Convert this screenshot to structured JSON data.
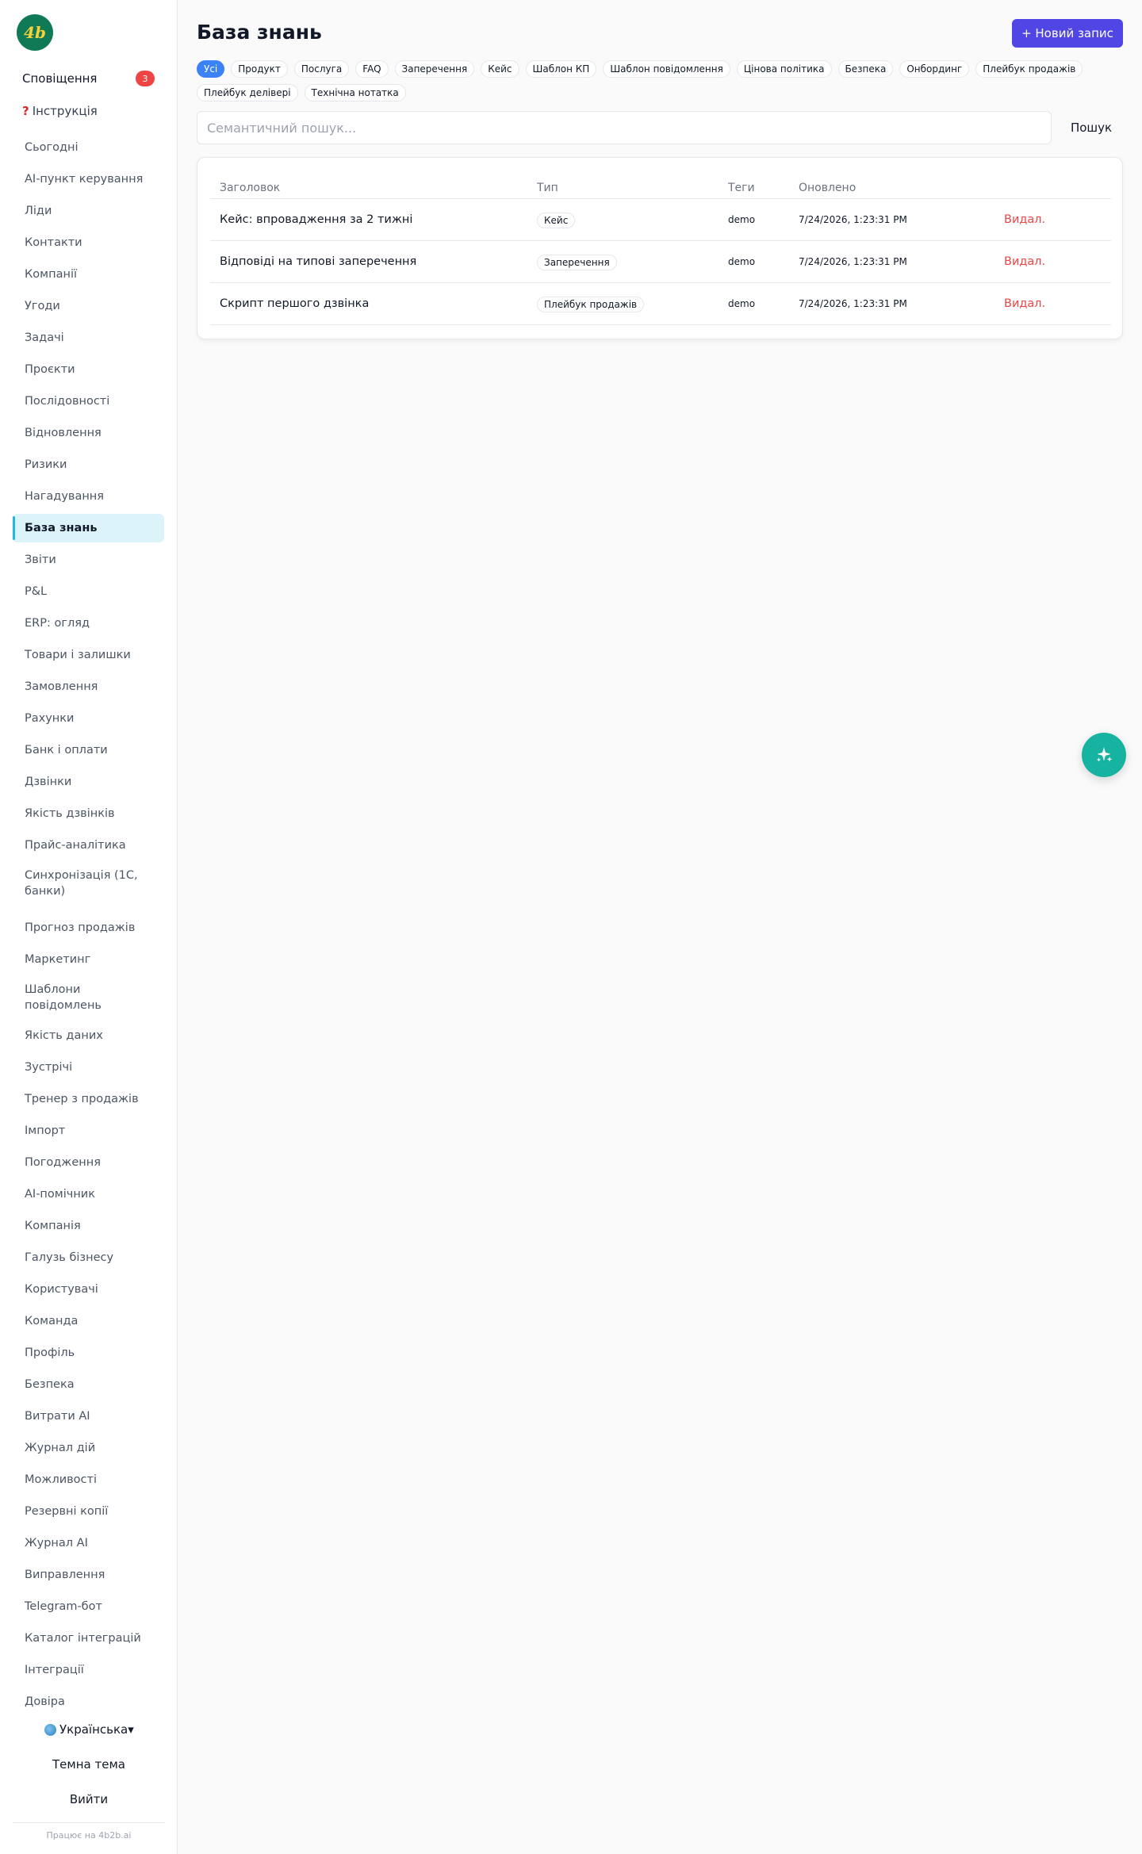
{
  "brand": {
    "logo_text": "4b",
    "logo_color": "#0f7a55"
  },
  "sidebar": {
    "notifications": {
      "label": "Сповіщення",
      "count": "3"
    },
    "help": {
      "label": "Інструкція"
    },
    "items": [
      "Сьогодні",
      "AI-пункт керування",
      "Ліди",
      "Контакти",
      "Компанії",
      "Угоди",
      "Задачі",
      "Проєкти",
      "Послідовності",
      "Відновлення",
      "Ризики",
      "Нагадування",
      "База знань",
      "Звіти",
      "P&L",
      "ERP: огляд",
      "Товари і залишки",
      "Замовлення",
      "Рахунки",
      "Банк і оплати",
      "Дзвінки",
      "Якість дзвінків",
      "Прайс-аналітика",
      "Синхронізація (1С, банки)",
      "Прогноз продажів",
      "Маркетинг",
      "Шаблони повідомлень",
      "Якість даних",
      "Зустрічі",
      "Тренер з продажів",
      "Імпорт",
      "Погодження",
      "AI-помічник",
      "Компанія",
      "Галузь бізнесу",
      "Користувачі",
      "Команда",
      "Профіль",
      "Безпека",
      "Витрати AI",
      "Журнал дій",
      "Можливості",
      "Резервні копії",
      "Журнал AI",
      "Виправлення",
      "Telegram-бот",
      "Каталог інтеграцій",
      "Інтеграції",
      "Довіра"
    ],
    "active_item": "База знань",
    "language": "Українська▾",
    "theme_label": "Темна тема",
    "logout_label": "Вийти",
    "powered_by": "Працює на 4b2b.ai"
  },
  "header": {
    "title": "База знань",
    "new_button": "+ Новий запис"
  },
  "filters": {
    "chips": [
      "Усі",
      "Продукт",
      "Послуга",
      "FAQ",
      "Заперечення",
      "Кейс",
      "Шаблон КП",
      "Шаблон повідомлення",
      "Цінова політика",
      "Безпека",
      "Онбординг",
      "Плейбук продажів",
      "Плейбук деліверi",
      "Технічна нотатка"
    ],
    "active": "Усі"
  },
  "search": {
    "placeholder": "Семантичний пошук...",
    "value": "",
    "button": "Пошук"
  },
  "table": {
    "columns": {
      "title": "Заголовок",
      "type": "Тип",
      "tags": "Теги",
      "updated": "Оновлено",
      "actions": ""
    },
    "rows": [
      {
        "title": "Кейс: впровадження за 2 тижні",
        "type": "Кейс",
        "tags": "demo",
        "updated": "7/24/2026, 1:23:31 PM",
        "action": "Видал."
      },
      {
        "title": "Відповіді на типові заперечення",
        "type": "Заперечення",
        "tags": "demo",
        "updated": "7/24/2026, 1:23:31 PM",
        "action": "Видал."
      },
      {
        "title": "Скрипт першого дзвінка",
        "type": "Плейбук продажів",
        "tags": "demo",
        "updated": "7/24/2026, 1:23:31 PM",
        "action": "Видал."
      }
    ]
  },
  "fab": {
    "icon": "sparkles-icon"
  },
  "colors": {
    "accent": "#4f46e5",
    "chip_active": "#3b82f6",
    "danger": "#ef4444",
    "fab": "#15b3a0",
    "nav_active_bg": "#ddf3fa"
  }
}
